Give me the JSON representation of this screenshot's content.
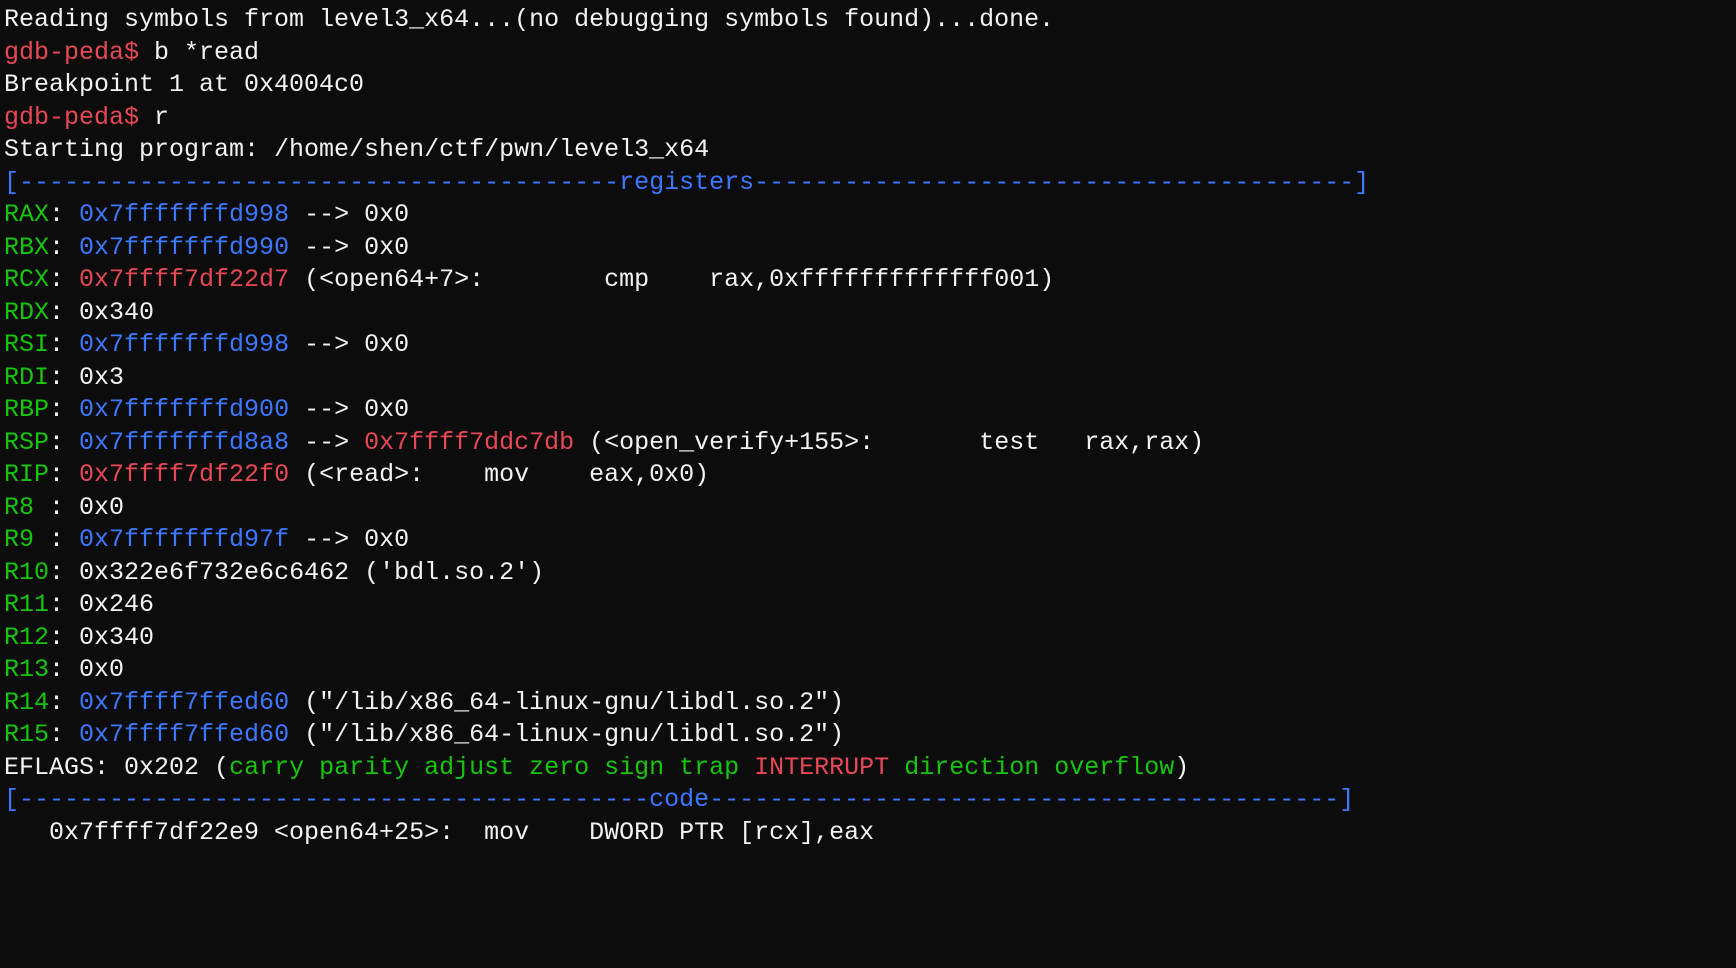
{
  "line0_partial": "Reading symbols from level3_x64...(no debugging symbols found)...done.",
  "prompt": "gdb-peda$",
  "cmd_b": " b *read",
  "breakpoint_text": "Breakpoint 1 at 0x4004c0",
  "cmd_r": " r",
  "starting": "Starting program: /home/shen/ctf/pwn/level3_x64",
  "sep_left": "[",
  "registers_dashes_left": "----------------------------------------",
  "registers_label": "registers",
  "registers_dashes_right": "----------------------------------------",
  "sep_right": "]",
  "reg": {
    "RAX": {
      "name": "RAX",
      "colon": ": ",
      "addr": "0x7fffffffd998",
      "arrow": " --> ",
      "val": "0x0"
    },
    "RBX": {
      "name": "RBX",
      "colon": ": ",
      "addr": "0x7fffffffd990",
      "arrow": " --> ",
      "val": "0x0"
    },
    "RCX": {
      "name": "RCX",
      "colon": ": ",
      "addr": "0x7ffff7df22d7",
      "rest": " (<open64+7>:        cmp    rax,0xfffffffffffff001)"
    },
    "RDX": {
      "name": "RDX",
      "colon": ": ",
      "val": "0x340"
    },
    "RSI": {
      "name": "RSI",
      "colon": ": ",
      "addr": "0x7fffffffd998",
      "arrow": " --> ",
      "val": "0x0"
    },
    "RDI": {
      "name": "RDI",
      "colon": ": ",
      "val": "0x3"
    },
    "RBP": {
      "name": "RBP",
      "colon": ": ",
      "addr": "0x7fffffffd900",
      "arrow": " --> ",
      "val": "0x0"
    },
    "RSP": {
      "name": "RSP",
      "colon": ": ",
      "addr": "0x7fffffffd8a8",
      "arrow": " --> ",
      "addr2": "0x7ffff7ddc7db",
      "rest": " (<open_verify+155>:       test   rax,rax)"
    },
    "RIP": {
      "name": "RIP",
      "colon": ": ",
      "addr": "0x7ffff7df22f0",
      "rest": " (<read>:    mov    eax,0x0)"
    },
    "R8": {
      "name": "R8 ",
      "colon": ": ",
      "val": "0x0"
    },
    "R9": {
      "name": "R9 ",
      "colon": ": ",
      "addr": "0x7fffffffd97f",
      "arrow": " --> ",
      "val": "0x0"
    },
    "R10": {
      "name": "R10",
      "colon": ": ",
      "val": "0x322e6f732e6c6462",
      "extra": " ('bdl.so.2')"
    },
    "R11": {
      "name": "R11",
      "colon": ": ",
      "val": "0x246"
    },
    "R12": {
      "name": "R12",
      "colon": ": ",
      "val": "0x340"
    },
    "R13": {
      "name": "R13",
      "colon": ": ",
      "val": "0x0"
    },
    "R14": {
      "name": "R14",
      "colon": ": ",
      "addr": "0x7ffff7ffed60",
      "rest": " (\"/lib/x86_64-linux-gnu/libdl.so.2\")"
    },
    "R15": {
      "name": "R15",
      "colon": ": ",
      "addr": "0x7ffff7ffed60",
      "rest": " (\"/lib/x86_64-linux-gnu/libdl.so.2\")"
    }
  },
  "eflags": {
    "label": "EFLAGS",
    "colon": ": ",
    "val": "0x202",
    "open": " (",
    "flags_off1": "carry parity adjust zero sign trap ",
    "flag_on": "INTERRUPT",
    "flags_off2": " direction overflow",
    "close": ")"
  },
  "code_dashes_left": "------------------------------------------",
  "code_label": "code",
  "code_dashes_right": "------------------------------------------",
  "bottom_partial_addr": "   0x7ffff7df22e9 <open64+25>:",
  "bottom_partial_rest": "  mov    DWORD PTR [rcx],eax"
}
